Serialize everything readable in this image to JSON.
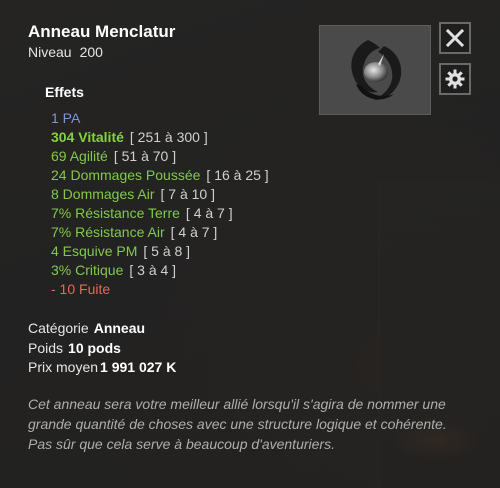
{
  "item": {
    "name": "Anneau Menclatur",
    "level_label": "Niveau",
    "level_value": "200",
    "image_icon": "ring-icon"
  },
  "buttons": {
    "close_icon": "close-icon",
    "settings_icon": "gear-icon"
  },
  "effects": {
    "title": "Effets",
    "lines": [
      {
        "text": "1 PA",
        "range": "",
        "color": "#7b96d6"
      },
      {
        "text": "304 Vitalité",
        "range": "[ 251 à 300 ]",
        "color": "#86d13f"
      },
      {
        "text": "69 Agilité",
        "range": "[ 51 à 70 ]",
        "color": "#82c94a"
      },
      {
        "text": "24 Dommages Poussée",
        "range": "[ 16 à 25 ]",
        "color": "#82c94a"
      },
      {
        "text": "8 Dommages Air",
        "range": "[ 7 à 10 ]",
        "color": "#82c94a"
      },
      {
        "text": "7% Résistance Terre",
        "range": "[ 4 à 7 ]",
        "color": "#82c94a"
      },
      {
        "text": "7% Résistance Air",
        "range": "[ 4 à 7 ]",
        "color": "#82c94a"
      },
      {
        "text": "4 Esquive PM",
        "range": "[ 5 à 8 ]",
        "color": "#82c94a"
      },
      {
        "text": "3% Critique",
        "range": "[ 3 à 4 ]",
        "color": "#82c94a"
      },
      {
        "text": "- 10 Fuite",
        "range": "",
        "color": "#e06a5a"
      }
    ]
  },
  "info": {
    "category_label": "Catégorie",
    "category_value": "Anneau",
    "weight_label": "Poids",
    "weight_value": "10 pods",
    "price_label": "Prix moyen",
    "price_value": "1 991 027 K"
  },
  "description": "Cet anneau sera votre meilleur allié lorsqu'il s'agira de nommer une grande quantité de choses avec une structure logique et cohérente. Pas sûr que cela serve à beaucoup d'aventuriers."
}
